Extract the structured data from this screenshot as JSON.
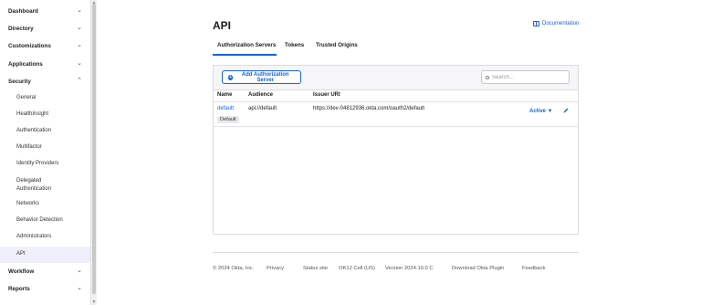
{
  "sidebar": {
    "sections": [
      {
        "label": "Dashboard",
        "chevron": "⌄"
      },
      {
        "label": "Directory",
        "chevron": "⌄"
      },
      {
        "label": "Customizations",
        "chevron": "⌄"
      },
      {
        "label": "Applications",
        "chevron": "⌄"
      },
      {
        "label": "Security",
        "chevron": "⌃"
      },
      {
        "label": "Workflow",
        "chevron": "⌄"
      },
      {
        "label": "Reports",
        "chevron": "⌄"
      }
    ],
    "security_items": [
      {
        "label": "General"
      },
      {
        "label": "HealthInsight"
      },
      {
        "label": "Authentication"
      },
      {
        "label": "Multifactor"
      },
      {
        "label": "Identity Providers"
      },
      {
        "label": "Delegated Authentication"
      },
      {
        "label": "Networks"
      },
      {
        "label": "Behavior Detection"
      },
      {
        "label": "Administrators"
      },
      {
        "label": "API"
      }
    ]
  },
  "page": {
    "title": "API",
    "documentation_link": "Documentation"
  },
  "tabs": [
    "Authorization Servers",
    "Tokens",
    "Trusted Origins"
  ],
  "toolbar": {
    "add_button": "Add Authorization Server",
    "search_placeholder": "Search..."
  },
  "table": {
    "headers": [
      "Name",
      "Audience",
      "Issuer URI"
    ],
    "rows": [
      {
        "name": "default",
        "audience": "api://default",
        "issuer_uri": "https://dev-04812936.okta.com/oauth2/default",
        "badge": "Default",
        "status": "Active ▼"
      }
    ]
  },
  "footer": {
    "copyright": "© 2024 Okta, Inc.",
    "privacy": "Privacy",
    "status_site": "Status site",
    "cell": "OK12 Cell (US)",
    "version": "Version 2024.10.0 C",
    "plugin": "Download Okta Plugin",
    "feedback": "Feedback"
  },
  "colors": {
    "accent": "#1662dd",
    "active_bg": "#eef1fb"
  }
}
